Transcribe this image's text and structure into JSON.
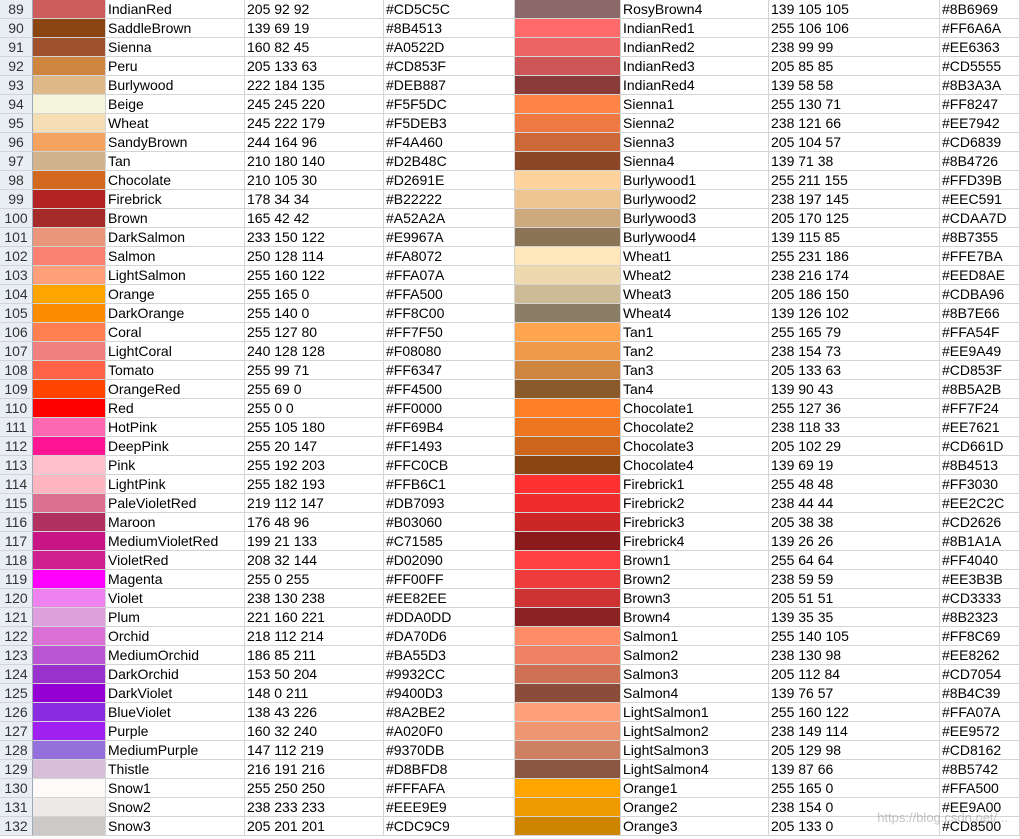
{
  "sheet": {
    "rows": [
      {
        "n": "89",
        "c1": "#CD5C5C",
        "name1": "IndianRed",
        "rgb1": "205 92 92",
        "hex1": "#CD5C5C",
        "c2": "#8B6969",
        "name2": "RosyBrown4",
        "rgb2": "139 105 105",
        "hex2": "#8B6969"
      },
      {
        "n": "90",
        "c1": "#8B4513",
        "name1": "SaddleBrown",
        "rgb1": "139 69 19",
        "hex1": "#8B4513",
        "c2": "#FF6A6A",
        "name2": "IndianRed1",
        "rgb2": "255 106 106",
        "hex2": "#FF6A6A"
      },
      {
        "n": "91",
        "c1": "#A0522D",
        "name1": "Sienna",
        "rgb1": "160 82 45",
        "hex1": "#A0522D",
        "c2": "#EE6363",
        "name2": "IndianRed2",
        "rgb2": "238 99 99",
        "hex2": "#EE6363"
      },
      {
        "n": "92",
        "c1": "#CD853F",
        "name1": "Peru",
        "rgb1": "205 133 63",
        "hex1": "#CD853F",
        "c2": "#CD5555",
        "name2": "IndianRed3",
        "rgb2": "205 85 85",
        "hex2": "#CD5555"
      },
      {
        "n": "93",
        "c1": "#DEB887",
        "name1": "Burlywood",
        "rgb1": "222 184 135",
        "hex1": "#DEB887",
        "c2": "#8B3A3A",
        "name2": "IndianRed4",
        "rgb2": "139 58 58",
        "hex2": "#8B3A3A"
      },
      {
        "n": "94",
        "c1": "#F5F5DC",
        "name1": "Beige",
        "rgb1": "245 245 220",
        "hex1": "#F5F5DC",
        "c2": "#FF8247",
        "name2": "Sienna1",
        "rgb2": "255 130 71",
        "hex2": "#FF8247"
      },
      {
        "n": "95",
        "c1": "#F5DEB3",
        "name1": "Wheat",
        "rgb1": "245 222 179",
        "hex1": "#F5DEB3",
        "c2": "#EE7942",
        "name2": "Sienna2",
        "rgb2": "238 121 66",
        "hex2": "#EE7942"
      },
      {
        "n": "96",
        "c1": "#F4A460",
        "name1": "SandyBrown",
        "rgb1": "244 164 96",
        "hex1": "#F4A460",
        "c2": "#CD6839",
        "name2": "Sienna3",
        "rgb2": "205 104 57",
        "hex2": "#CD6839"
      },
      {
        "n": "97",
        "c1": "#D2B48C",
        "name1": "Tan",
        "rgb1": "210 180 140",
        "hex1": "#D2B48C",
        "c2": "#8B4726",
        "name2": "Sienna4",
        "rgb2": "139 71 38",
        "hex2": "#8B4726"
      },
      {
        "n": "98",
        "c1": "#D2691E",
        "name1": "Chocolate",
        "rgb1": "210 105 30",
        "hex1": "#D2691E",
        "c2": "#FFD39B",
        "name2": "Burlywood1",
        "rgb2": "255 211 155",
        "hex2": "#FFD39B"
      },
      {
        "n": "99",
        "c1": "#B22222",
        "name1": "Firebrick",
        "rgb1": "178 34 34",
        "hex1": "#B22222",
        "c2": "#EEC591",
        "name2": "Burlywood2",
        "rgb2": "238 197 145",
        "hex2": "#EEC591"
      },
      {
        "n": "100",
        "c1": "#A52A2A",
        "name1": "Brown",
        "rgb1": "165 42 42",
        "hex1": "#A52A2A",
        "c2": "#CDAA7D",
        "name2": "Burlywood3",
        "rgb2": "205 170 125",
        "hex2": "#CDAA7D"
      },
      {
        "n": "101",
        "c1": "#E9967A",
        "name1": "DarkSalmon",
        "rgb1": "233 150 122",
        "hex1": "#E9967A",
        "c2": "#8B7355",
        "name2": "Burlywood4",
        "rgb2": "139 115 85",
        "hex2": "#8B7355"
      },
      {
        "n": "102",
        "c1": "#FA8072",
        "name1": "Salmon",
        "rgb1": "250 128 114",
        "hex1": "#FA8072",
        "c2": "#FFE7BA",
        "name2": "Wheat1",
        "rgb2": "255 231 186",
        "hex2": "#FFE7BA"
      },
      {
        "n": "103",
        "c1": "#FFA07A",
        "name1": "LightSalmon",
        "rgb1": "255 160 122",
        "hex1": "#FFA07A",
        "c2": "#EED8AE",
        "name2": "Wheat2",
        "rgb2": "238 216 174",
        "hex2": "#EED8AE"
      },
      {
        "n": "104",
        "c1": "#FFA500",
        "name1": "Orange",
        "rgb1": "255 165 0",
        "hex1": "#FFA500",
        "c2": "#CDBA96",
        "name2": "Wheat3",
        "rgb2": "205 186 150",
        "hex2": "#CDBA96"
      },
      {
        "n": "105",
        "c1": "#FF8C00",
        "name1": "DarkOrange",
        "rgb1": "255 140 0",
        "hex1": "#FF8C00",
        "c2": "#8B7E66",
        "name2": "Wheat4",
        "rgb2": "139 126 102",
        "hex2": "#8B7E66"
      },
      {
        "n": "106",
        "c1": "#FF7F50",
        "name1": "Coral",
        "rgb1": "255 127 80",
        "hex1": "#FF7F50",
        "c2": "#FFA54F",
        "name2": "Tan1",
        "rgb2": "255 165 79",
        "hex2": "#FFA54F"
      },
      {
        "n": "107",
        "c1": "#F08080",
        "name1": "LightCoral",
        "rgb1": "240 128 128",
        "hex1": "#F08080",
        "c2": "#EE9A49",
        "name2": "Tan2",
        "rgb2": "238 154 73",
        "hex2": "#EE9A49"
      },
      {
        "n": "108",
        "c1": "#FF6347",
        "name1": "Tomato",
        "rgb1": "255 99 71",
        "hex1": "#FF6347",
        "c2": "#CD853F",
        "name2": "Tan3",
        "rgb2": "205 133 63",
        "hex2": "#CD853F"
      },
      {
        "n": "109",
        "c1": "#FF4500",
        "name1": "OrangeRed",
        "rgb1": "255 69 0",
        "hex1": "#FF4500",
        "c2": "#8B5A2B",
        "name2": "Tan4",
        "rgb2": "139 90 43",
        "hex2": "#8B5A2B"
      },
      {
        "n": "110",
        "c1": "#FF0000",
        "name1": "Red",
        "rgb1": "255 0 0",
        "hex1": "#FF0000",
        "c2": "#FF7F24",
        "name2": "Chocolate1",
        "rgb2": "255 127 36",
        "hex2": "#FF7F24"
      },
      {
        "n": "111",
        "c1": "#FF69B4",
        "name1": "HotPink",
        "rgb1": "255 105 180",
        "hex1": "#FF69B4",
        "c2": "#EE7621",
        "name2": "Chocolate2",
        "rgb2": "238 118 33",
        "hex2": "#EE7621"
      },
      {
        "n": "112",
        "c1": "#FF1493",
        "name1": "DeepPink",
        "rgb1": "255 20 147",
        "hex1": "#FF1493",
        "c2": "#CD661D",
        "name2": "Chocolate3",
        "rgb2": "205 102 29",
        "hex2": "#CD661D"
      },
      {
        "n": "113",
        "c1": "#FFC0CB",
        "name1": "Pink",
        "rgb1": "255 192 203",
        "hex1": "#FFC0CB",
        "c2": "#8B4513",
        "name2": "Chocolate4",
        "rgb2": "139 69 19",
        "hex2": "#8B4513"
      },
      {
        "n": "114",
        "c1": "#FFB6C1",
        "name1": "LightPink",
        "rgb1": "255 182 193",
        "hex1": "#FFB6C1",
        "c2": "#FF3030",
        "name2": "Firebrick1",
        "rgb2": "255 48 48",
        "hex2": "#FF3030"
      },
      {
        "n": "115",
        "c1": "#DB7093",
        "name1": "PaleVioletRed",
        "rgb1": "219 112 147",
        "hex1": "#DB7093",
        "c2": "#EE2C2C",
        "name2": "Firebrick2",
        "rgb2": "238 44 44",
        "hex2": "#EE2C2C"
      },
      {
        "n": "116",
        "c1": "#B03060",
        "name1": "Maroon",
        "rgb1": "176 48 96",
        "hex1": "#B03060",
        "c2": "#CD2626",
        "name2": "Firebrick3",
        "rgb2": "205 38 38",
        "hex2": "#CD2626"
      },
      {
        "n": "117",
        "c1": "#C71585",
        "name1": "MediumVioletRed",
        "rgb1": "199 21 133",
        "hex1": "#C71585",
        "c2": "#8B1A1A",
        "name2": "Firebrick4",
        "rgb2": "139 26 26",
        "hex2": "#8B1A1A"
      },
      {
        "n": "118",
        "c1": "#D02090",
        "name1": "VioletRed",
        "rgb1": "208 32 144",
        "hex1": "#D02090",
        "c2": "#FF4040",
        "name2": "Brown1",
        "rgb2": "255 64 64",
        "hex2": "#FF4040"
      },
      {
        "n": "119",
        "c1": "#FF00FF",
        "name1": "Magenta",
        "rgb1": "255 0 255",
        "hex1": "#FF00FF",
        "c2": "#EE3B3B",
        "name2": "Brown2",
        "rgb2": "238 59 59",
        "hex2": "#EE3B3B"
      },
      {
        "n": "120",
        "c1": "#EE82EE",
        "name1": "Violet",
        "rgb1": "238 130 238",
        "hex1": "#EE82EE",
        "c2": "#CD3333",
        "name2": "Brown3",
        "rgb2": "205 51 51",
        "hex2": "#CD3333"
      },
      {
        "n": "121",
        "c1": "#DDA0DD",
        "name1": "Plum",
        "rgb1": "221 160 221",
        "hex1": "#DDA0DD",
        "c2": "#8B2323",
        "name2": "Brown4",
        "rgb2": "139 35 35",
        "hex2": "#8B2323"
      },
      {
        "n": "122",
        "c1": "#DA70D6",
        "name1": "Orchid",
        "rgb1": "218 112 214",
        "hex1": "#DA70D6",
        "c2": "#FF8C69",
        "name2": "Salmon1",
        "rgb2": "255 140 105",
        "hex2": "#FF8C69"
      },
      {
        "n": "123",
        "c1": "#BA55D3",
        "name1": "MediumOrchid",
        "rgb1": "186 85 211",
        "hex1": "#BA55D3",
        "c2": "#EE8262",
        "name2": "Salmon2",
        "rgb2": "238 130 98",
        "hex2": "#EE8262"
      },
      {
        "n": "124",
        "c1": "#9932CC",
        "name1": "DarkOrchid",
        "rgb1": "153 50 204",
        "hex1": "#9932CC",
        "c2": "#CD7054",
        "name2": "Salmon3",
        "rgb2": "205 112 84",
        "hex2": "#CD7054"
      },
      {
        "n": "125",
        "c1": "#9400D3",
        "name1": "DarkViolet",
        "rgb1": "148 0 211",
        "hex1": "#9400D3",
        "c2": "#8B4C39",
        "name2": "Salmon4",
        "rgb2": "139 76 57",
        "hex2": "#8B4C39"
      },
      {
        "n": "126",
        "c1": "#8A2BE2",
        "name1": "BlueViolet",
        "rgb1": "138 43 226",
        "hex1": "#8A2BE2",
        "c2": "#FFA07A",
        "name2": "LightSalmon1",
        "rgb2": "255 160 122",
        "hex2": "#FFA07A"
      },
      {
        "n": "127",
        "c1": "#A020F0",
        "name1": "Purple",
        "rgb1": "160 32 240",
        "hex1": "#A020F0",
        "c2": "#EE9572",
        "name2": "LightSalmon2",
        "rgb2": "238 149 114",
        "hex2": "#EE9572"
      },
      {
        "n": "128",
        "c1": "#9370DB",
        "name1": "MediumPurple",
        "rgb1": "147 112 219",
        "hex1": "#9370DB",
        "c2": "#CD8162",
        "name2": "LightSalmon3",
        "rgb2": "205 129 98",
        "hex2": "#CD8162"
      },
      {
        "n": "129",
        "c1": "#D8BFD8",
        "name1": "Thistle",
        "rgb1": "216 191 216",
        "hex1": "#D8BFD8",
        "c2": "#8B5742",
        "name2": "LightSalmon4",
        "rgb2": "139 87 66",
        "hex2": "#8B5742"
      },
      {
        "n": "130",
        "c1": "#FFFAFA",
        "name1": "Snow1",
        "rgb1": "255 250 250",
        "hex1": "#FFFAFA",
        "c2": "#FFA500",
        "name2": "Orange1",
        "rgb2": "255 165 0",
        "hex2": "#FFA500"
      },
      {
        "n": "131",
        "c1": "#EEE9E9",
        "name1": "Snow2",
        "rgb1": "238 233 233",
        "hex1": "#EEE9E9",
        "c2": "#EE9A00",
        "name2": "Orange2",
        "rgb2": "238 154 0",
        "hex2": "#EE9A00"
      },
      {
        "n": "132",
        "c1": "#CDC9C9",
        "name1": "Snow3",
        "rgb1": "205 201 201",
        "hex1": "#CDC9C9",
        "c2": "#CD8500",
        "name2": "Orange3",
        "rgb2": "205 133 0",
        "hex2": "#CD8500"
      }
    ]
  },
  "watermark": "https://blog.csdn.net/..."
}
